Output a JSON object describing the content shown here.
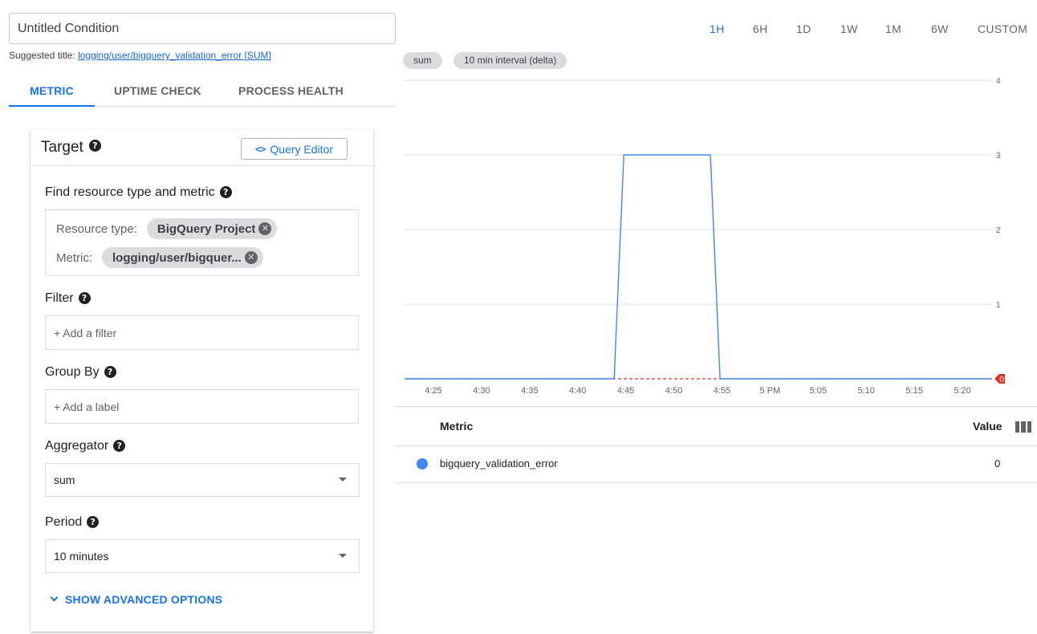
{
  "condition": {
    "title_value": "Untitled Condition",
    "suggested_prefix": "Suggested title:",
    "suggested_link": "logging/user/bigquery_validation_error [SUM]"
  },
  "tabs": [
    {
      "label": "METRIC",
      "active": true
    },
    {
      "label": "UPTIME CHECK",
      "active": false
    },
    {
      "label": "PROCESS HEALTH",
      "active": false
    }
  ],
  "target": {
    "title": "Target",
    "query_editor_label": "Query Editor",
    "find_label": "Find resource type and metric",
    "resource_type_label": "Resource type:",
    "resource_type_value": "BigQuery Project",
    "metric_label": "Metric:",
    "metric_value": "logging/user/bigquer...",
    "filter_label": "Filter",
    "filter_placeholder": "+ Add a filter",
    "groupby_label": "Group By",
    "groupby_placeholder": "+ Add a label",
    "aggregator_label": "Aggregator",
    "aggregator_value": "sum",
    "period_label": "Period",
    "period_value": "10 minutes",
    "advanced_label": "SHOW ADVANCED OPTIONS"
  },
  "time_ranges": [
    {
      "label": "1H",
      "active": true
    },
    {
      "label": "6H",
      "active": false
    },
    {
      "label": "1D",
      "active": false
    },
    {
      "label": "1W",
      "active": false
    },
    {
      "label": "1M",
      "active": false
    },
    {
      "label": "6W",
      "active": false
    },
    {
      "label": "CUSTOM",
      "active": false
    }
  ],
  "chart_pills": [
    "sum",
    "10 min interval (delta)"
  ],
  "colors": {
    "accent": "#1a73e8",
    "series": "#4285f4",
    "threshold": "#d93025"
  },
  "chart_data": {
    "type": "line",
    "title": "",
    "x_ticks": [
      "4:25",
      "4:30",
      "4:35",
      "4:40",
      "4:45",
      "4:50",
      "4:55",
      "5 PM",
      "5:05",
      "5:10",
      "5:15",
      "5:20"
    ],
    "y_ticks": [
      0,
      1,
      2,
      3,
      4
    ],
    "ylim": [
      0,
      4
    ],
    "x_unit": "minutes since 4:25",
    "xlim": [
      -3,
      58
    ],
    "series": [
      {
        "name": "bigquery_validation_error",
        "x": [
          -3,
          18.8,
          19.8,
          28.8,
          29.8,
          58
        ],
        "y": [
          0,
          0,
          3,
          3,
          0,
          0
        ]
      }
    ],
    "threshold": {
      "value": 0,
      "label": "0"
    },
    "grid": true
  },
  "metric_table": {
    "header_metric": "Metric",
    "header_value": "Value",
    "rows": [
      {
        "name": "bigquery_validation_error",
        "value": "0"
      }
    ]
  }
}
